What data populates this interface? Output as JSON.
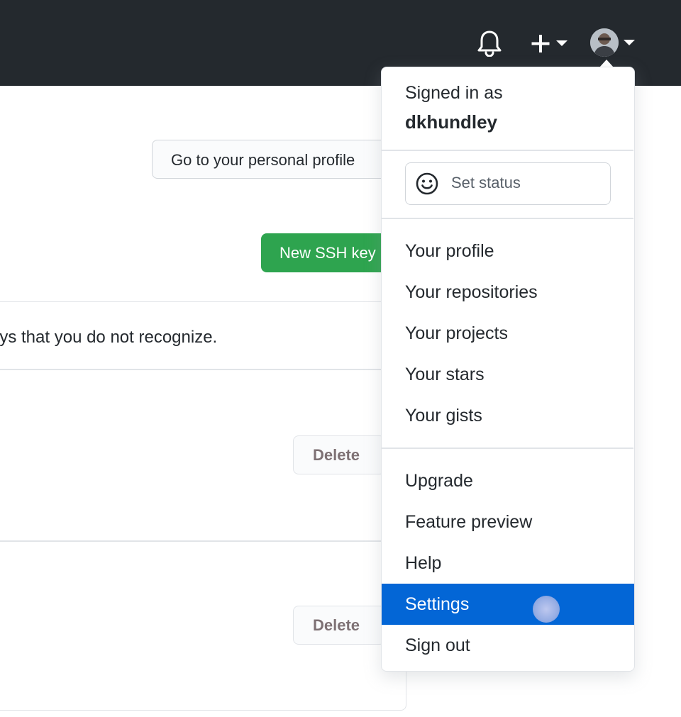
{
  "header": {
    "icons": {
      "notifications": "bell-icon",
      "create": "plus-icon",
      "caret": "caret-down-icon",
      "avatar": "avatar"
    }
  },
  "page": {
    "profile_button": "Go to your personal profile",
    "new_key_button": "New SSH key",
    "warning_text": "Check out our guide to generating SSH keys or troubleshoot common SSH problems. Make sure you remove keys that you do not recognize.",
    "visible_warning_fragment": "eys that you do not recognize.",
    "delete_label": "Delete"
  },
  "dropdown": {
    "signed_in_label": "Signed in as",
    "username": "dkhundley",
    "set_status": "Set status",
    "items": [
      {
        "label": "Your profile"
      },
      {
        "label": "Your repositories"
      },
      {
        "label": "Your projects"
      },
      {
        "label": "Your stars"
      },
      {
        "label": "Your gists"
      },
      {
        "label": "Upgrade"
      },
      {
        "label": "Feature preview"
      },
      {
        "label": "Help"
      },
      {
        "label": "Settings",
        "active": true
      },
      {
        "label": "Sign out"
      }
    ]
  },
  "colors": {
    "header_bg": "#24292e",
    "primary_green": "#2ea44f",
    "active_blue": "#0366d6",
    "border": "#e1e4e8"
  }
}
